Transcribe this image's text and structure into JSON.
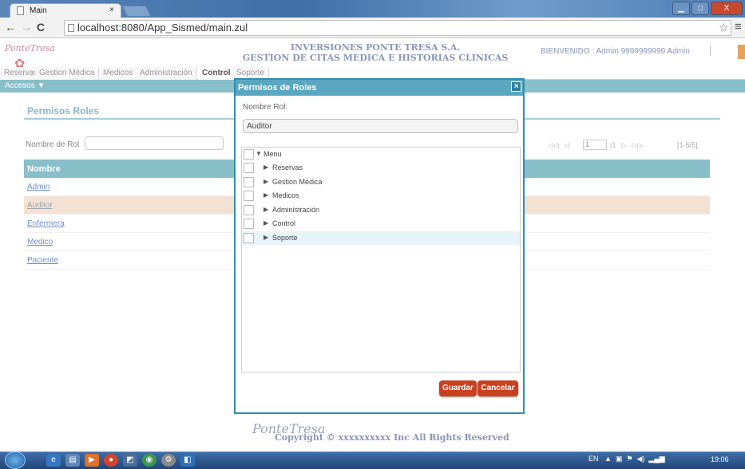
{
  "browser": {
    "tab_title": "Main",
    "tab_close": "×",
    "url": "localhost:8080/App_Sismed/main.zul",
    "window_buttons": [
      "▁",
      "□",
      "X"
    ]
  },
  "header": {
    "logo_text": "PonteTresa",
    "company_line1": "INVERSIONES PONTE TRESA S.A.",
    "company_line2": "GESTION DE CITAS MEDICA E HISTORIAS CLINICAS",
    "welcome": "BIENVENIDO : Admin 9999999999 Admin"
  },
  "nav": {
    "tabs": [
      "Reservas",
      "Gestion Médica",
      "Medicos",
      "Administración",
      "Control",
      "Soporte"
    ],
    "active": "Control",
    "submenu": "Accesos ▼"
  },
  "page": {
    "title": "Permisos Roles",
    "filter_label": "Nombre de Rol",
    "pager_controls": "◁◁ ◁",
    "pager_page": "1",
    "pager_of": "/1 ▷ ▷▷",
    "pager_info": "[1-5/5]",
    "grid_header": "Nombre",
    "rows": [
      "Admin",
      "Auditor",
      "Enfermera",
      "Medico",
      "Paciente"
    ],
    "selected_row": "Auditor"
  },
  "modal": {
    "title": "Permisos de Roles",
    "close": "×",
    "name_label": "Nombre Rol:",
    "name_value": "Auditor",
    "tree_root": "Menu",
    "tree_items": [
      "Reservas",
      "Gestion Médica",
      "Medicos",
      "Administración",
      "Control",
      "Soporte"
    ],
    "save": "Guardar",
    "cancel": "Cancelar"
  },
  "footer": {
    "logo_text": "PonteTresa",
    "copyright": "Copyright © xxxxxxxxxx Inc All Rights Reserved"
  },
  "taskbar": {
    "lang": "EN",
    "time": "19:06"
  },
  "colors": {
    "accent": "#88bfc9",
    "modal_border": "#2d8fae",
    "button": "#c9401f",
    "selected_row": "#f3e2d4"
  }
}
